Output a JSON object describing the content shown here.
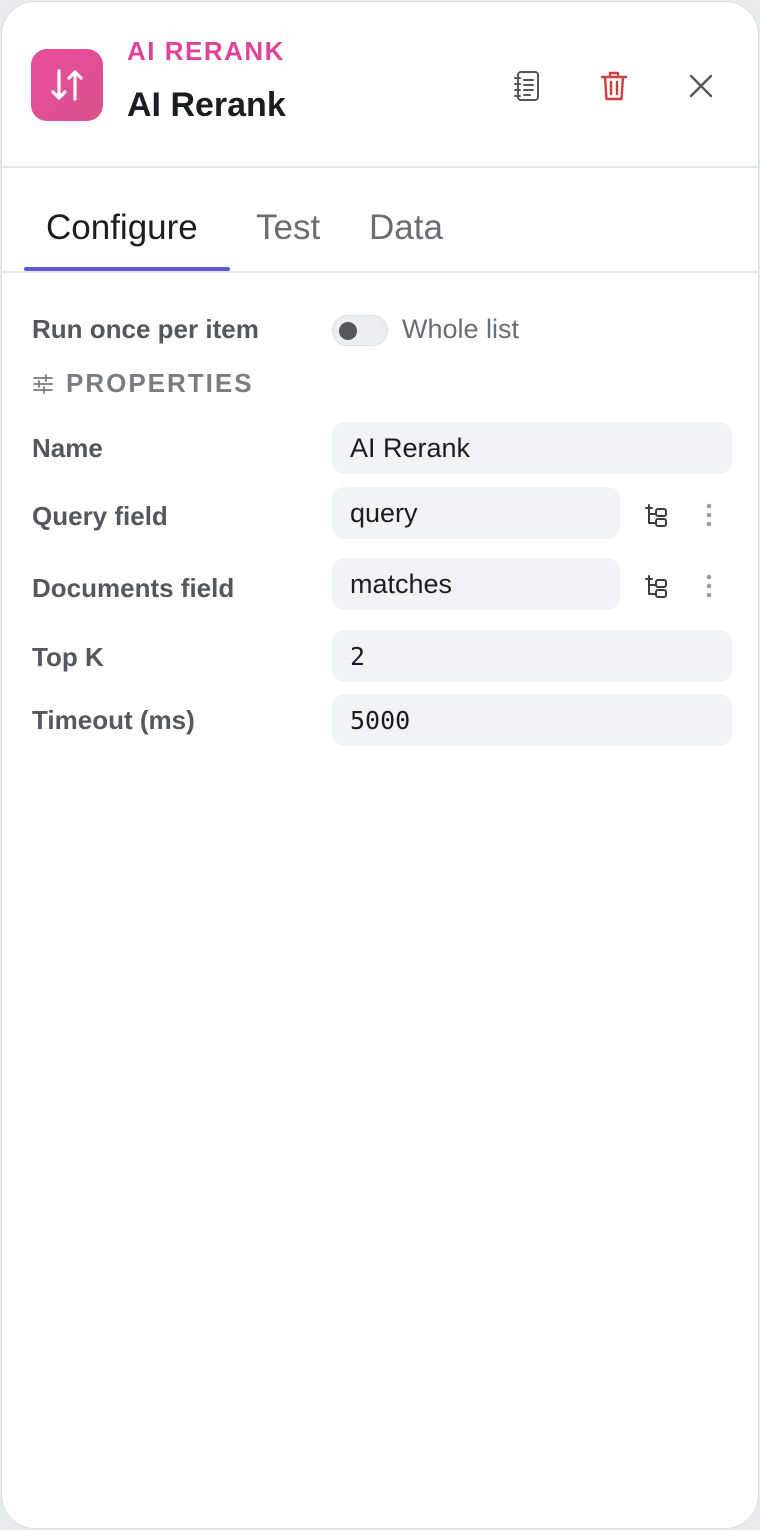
{
  "header": {
    "node_type": "AI RERANK",
    "title": "AI Rerank",
    "accent_color": "#e0449a",
    "icon": "up-down-arrows-icon",
    "actions": [
      "notebook-icon",
      "trash-icon",
      "close-icon"
    ]
  },
  "tabs": [
    {
      "label": "Configure",
      "active": true
    },
    {
      "label": "Test",
      "active": false
    },
    {
      "label": "Data",
      "active": false
    }
  ],
  "run_mode": {
    "label": "Run once per item",
    "toggle_text": "Whole list",
    "toggle_on": false
  },
  "section": {
    "icon": "sliders-icon",
    "title": "PROPERTIES"
  },
  "fields": {
    "name": {
      "label": "Name",
      "value": "AI Rerank"
    },
    "query": {
      "label": "Query field",
      "value": "query"
    },
    "documents": {
      "label": "Documents field",
      "value": "matches"
    },
    "top_k": {
      "label": "Top K",
      "value": "2"
    },
    "timeout": {
      "label": "Timeout (ms)",
      "value": "5000"
    }
  }
}
